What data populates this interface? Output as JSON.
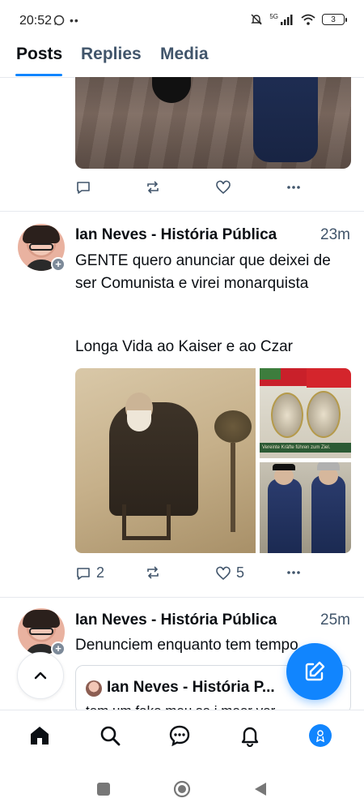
{
  "status_bar": {
    "time": "20:52",
    "network": "5G",
    "battery": "3",
    "icons": [
      "whatsapp-icon",
      "more-dots-icon",
      "mute-icon",
      "signal-icon",
      "wifi-icon",
      "battery-icon"
    ]
  },
  "tabs": [
    {
      "label": "Posts",
      "active": true
    },
    {
      "label": "Replies",
      "active": false
    },
    {
      "label": "Media",
      "active": false
    }
  ],
  "accent_color": "#1185fe",
  "posts": [
    {
      "actions": {
        "reply_count": "",
        "repost_count": "",
        "like_count": ""
      }
    },
    {
      "author": "Ian Neves - História Pública",
      "time": "23m",
      "text_line1": "GENTE quero anunciar que deixei de ser Comunista e virei monarquista",
      "text_line2": "Longa Vida ao Kaiser e ao Czar",
      "actions": {
        "reply_count": "2",
        "repost_count": "",
        "like_count": "5"
      },
      "image_caption": "Vereinte Kräfte führen zum Ziel."
    },
    {
      "author": "Ian Neves - História Pública",
      "time": "25m",
      "text": "Denunciem enquanto tem tempo",
      "quote": {
        "author": "Ian Neves - História P...",
        "text": "tem um fake meu se i meer ver"
      }
    }
  ],
  "bottom_nav": [
    "home-icon",
    "search-icon",
    "chat-icon",
    "notifications-icon",
    "profile-avatar"
  ],
  "system_nav": [
    "recents-button",
    "home-button",
    "back-button"
  ]
}
